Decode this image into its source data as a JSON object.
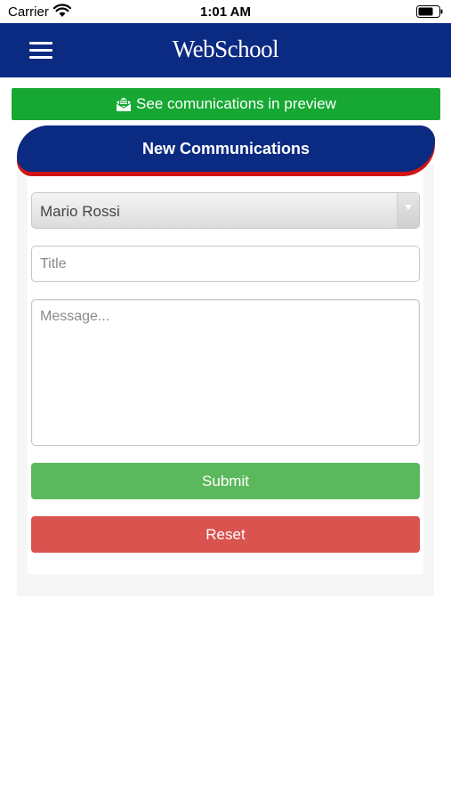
{
  "status_bar": {
    "carrier": "Carrier",
    "time": "1:01 AM"
  },
  "navbar": {
    "brand": "WebSchool",
    "menu_icon": "hamburger-menu-icon"
  },
  "preview_button": {
    "label": "See comunications in preview",
    "icon": "envelope-open-icon",
    "color": "#16a832"
  },
  "panel": {
    "title": "New Communications",
    "title_bg": "#0b2a82",
    "accent": "#d01416"
  },
  "form": {
    "recipient": {
      "selected": "Mario Rossi"
    },
    "title_field": {
      "value": "",
      "placeholder": "Title"
    },
    "message_field": {
      "value": "",
      "placeholder": "Message..."
    },
    "submit_label": "Submit",
    "reset_label": "Reset",
    "submit_color": "#5cb85c",
    "reset_color": "#d9534f"
  }
}
